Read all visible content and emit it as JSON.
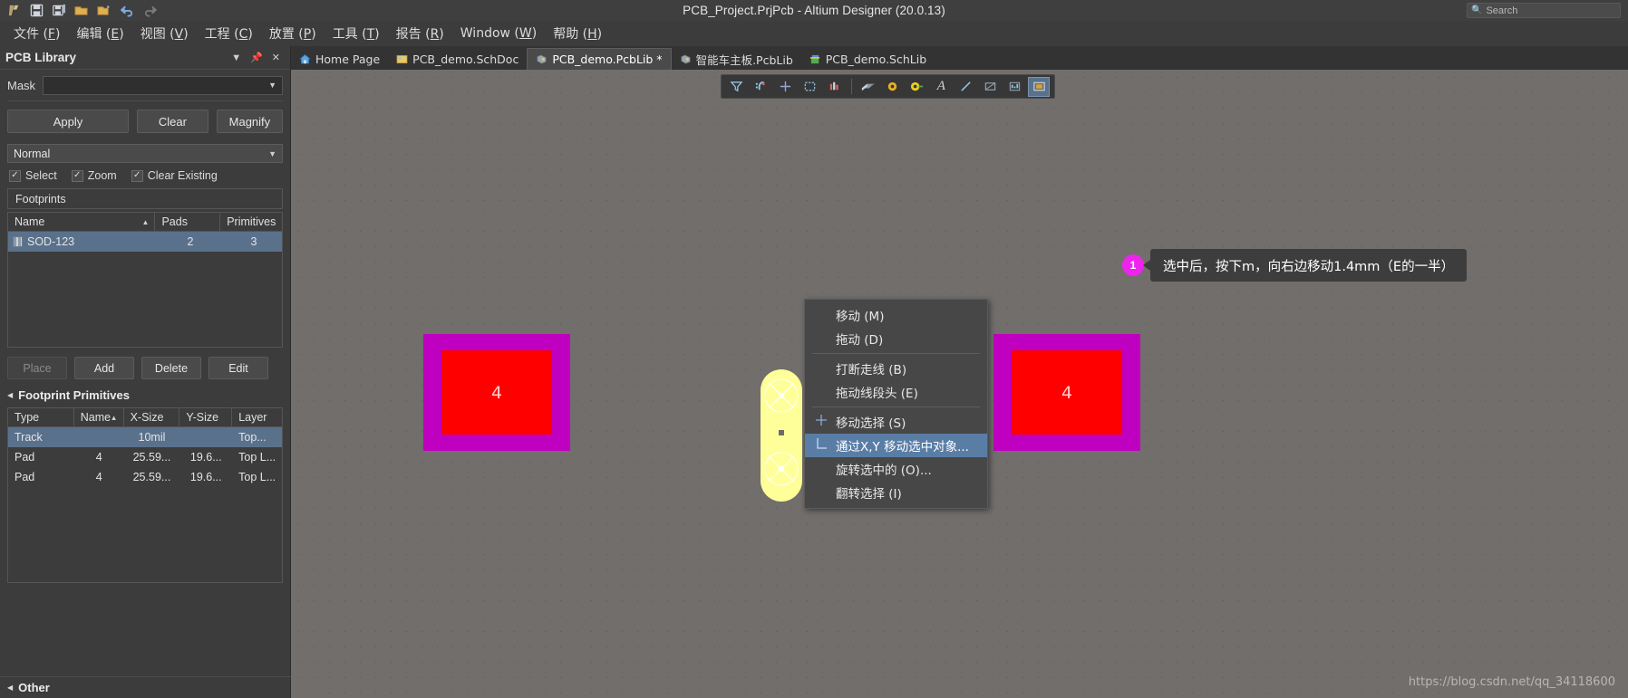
{
  "titlebar": {
    "title": "PCB_Project.PrjPcb - Altium Designer (20.0.13)",
    "search_placeholder": "Search",
    "quick_access": [
      {
        "name": "altium-logo-icon",
        "label": "A"
      },
      {
        "name": "save-icon",
        "label": "Save"
      },
      {
        "name": "save-all-icon",
        "label": "Save All"
      },
      {
        "name": "open-icon",
        "label": "Open"
      },
      {
        "name": "open-project-icon",
        "label": "Open Project"
      },
      {
        "name": "undo-icon",
        "label": "Undo"
      },
      {
        "name": "redo-icon",
        "label": "Redo"
      }
    ]
  },
  "menubar": {
    "items": [
      {
        "text": "文件",
        "key": "F"
      },
      {
        "text": "编辑",
        "key": "E"
      },
      {
        "text": "视图",
        "key": "V"
      },
      {
        "text": "工程",
        "key": "C"
      },
      {
        "text": "放置",
        "key": "P"
      },
      {
        "text": "工具",
        "key": "T"
      },
      {
        "text": "报告",
        "key": "R"
      },
      {
        "text": "Window",
        "key": "W"
      },
      {
        "text": "帮助",
        "key": "H"
      }
    ]
  },
  "left_panel": {
    "title": "PCB Library",
    "mask_label": "Mask",
    "mask_value": "",
    "buttons": {
      "apply": "Apply",
      "clear": "Clear",
      "magnify": "Magnify"
    },
    "mode_value": "Normal",
    "checkboxes": [
      {
        "label": "Select",
        "checked": true
      },
      {
        "label": "Zoom",
        "checked": true
      },
      {
        "label": "Clear Existing",
        "checked": true
      }
    ],
    "footprints_title": "Footprints",
    "footprints_columns": [
      "Name",
      "Pads",
      "Primitives"
    ],
    "footprints_rows": [
      {
        "name": "SOD-123",
        "pads": "2",
        "primitives": "3",
        "selected": true
      }
    ],
    "action_buttons": [
      {
        "label": "Place",
        "disabled": true
      },
      {
        "label": "Add",
        "disabled": false
      },
      {
        "label": "Delete",
        "disabled": false
      },
      {
        "label": "Edit",
        "disabled": false
      }
    ],
    "primitives_title": "Footprint Primitives",
    "primitives_columns": [
      "Type",
      "Name",
      "X-Size",
      "Y-Size",
      "Layer"
    ],
    "primitives_rows": [
      {
        "type": "Track",
        "name": "",
        "x": "10mil",
        "y": "",
        "layer": "Top...",
        "selected": true
      },
      {
        "type": "Pad",
        "name": "4",
        "x": "25.59...",
        "y": "19.6...",
        "layer": "Top L...",
        "selected": false
      },
      {
        "type": "Pad",
        "name": "4",
        "x": "25.59...",
        "y": "19.6...",
        "layer": "Top L...",
        "selected": false
      }
    ],
    "other_title": "Other"
  },
  "tabs": [
    {
      "label": "Home Page",
      "icon": "home-icon",
      "active": false
    },
    {
      "label": "PCB_demo.SchDoc",
      "icon": "schdoc-icon",
      "active": false
    },
    {
      "label": "PCB_demo.PcbLib *",
      "icon": "pcblib-icon",
      "active": true
    },
    {
      "label": "智能车主板.PcbLib",
      "icon": "pcblib-icon",
      "active": false
    },
    {
      "label": "PCB_demo.SchLib",
      "icon": "schlib-icon",
      "active": false
    }
  ],
  "canvas_toolbar": {
    "items": [
      {
        "name": "filter-icon",
        "glyph": "filter"
      },
      {
        "name": "magnet-snap-icon",
        "glyph": "magnet"
      },
      {
        "name": "crosshair-icon",
        "glyph": "cross"
      },
      {
        "name": "selection-box-icon",
        "glyph": "dashbox"
      },
      {
        "name": "layer-stack-icon",
        "glyph": "bars"
      },
      {
        "name": "board-icon",
        "glyph": "board"
      },
      {
        "name": "via-icon",
        "glyph": "via"
      },
      {
        "name": "pad-icon",
        "glyph": "pad"
      },
      {
        "name": "text-icon",
        "glyph": "A"
      },
      {
        "name": "line-icon",
        "glyph": "line"
      },
      {
        "name": "rectangle-icon",
        "glyph": "rect"
      },
      {
        "name": "dimension-icon",
        "glyph": "dim"
      },
      {
        "name": "fill-icon",
        "glyph": "fill"
      }
    ]
  },
  "annotation": {
    "badge_number": "1",
    "text": "选中后，按下m，向右边移动1.4mm（E的一半）"
  },
  "context_menu": {
    "items": [
      {
        "label": "移动 (M)",
        "icon": "",
        "highlighted": false,
        "sep_after": false
      },
      {
        "label": "拖动 (D)",
        "icon": "",
        "highlighted": false,
        "sep_after": true
      },
      {
        "label": "打断走线 (B)",
        "icon": "",
        "highlighted": false,
        "sep_after": false
      },
      {
        "label": "拖动线段头 (E)",
        "icon": "",
        "highlighted": false,
        "sep_after": true
      },
      {
        "label": "移动选择 (S)",
        "icon": "move-selection-icon",
        "highlighted": false,
        "sep_after": false
      },
      {
        "label": "通过X,Y 移动选中对象...",
        "icon": "move-xy-icon",
        "highlighted": true,
        "sep_after": false
      },
      {
        "label": "旋转选中的 (O)...",
        "icon": "",
        "highlighted": false,
        "sep_after": false
      },
      {
        "label": "翻转选择 (I)",
        "icon": "",
        "highlighted": false,
        "sep_after": false
      }
    ]
  },
  "footprints_on_canvas": [
    {
      "name": "footprint-left",
      "number": "4"
    },
    {
      "name": "footprint-right",
      "number": "4"
    }
  ],
  "watermark": "https://blog.csdn.net/qq_34118600",
  "colors": {
    "pad_red": "#ff0000",
    "outline_purple": "#c000c0",
    "pad_yellow": "#ffff99",
    "badge_magenta": "#ee24ee",
    "menu_highlight": "#5a7da6",
    "selection_blue": "#5a718c"
  }
}
